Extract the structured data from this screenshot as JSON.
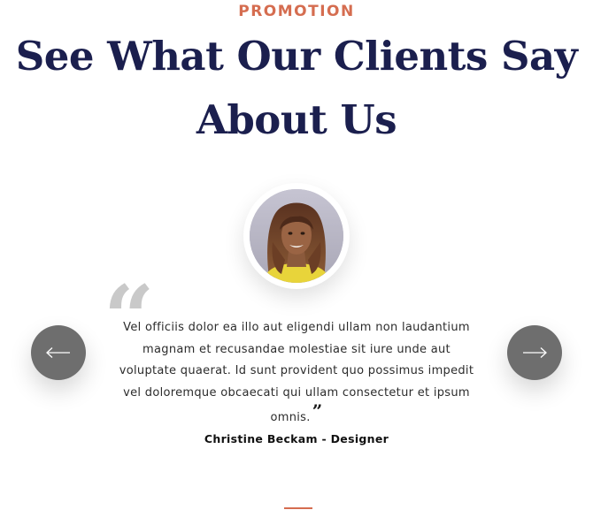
{
  "section": {
    "eyebrow": "PROMOTION",
    "headline": "See What Our Clients Say About Us"
  },
  "testimonial": {
    "quote": "Vel officiis dolor ea illo aut eligendi ullam non laudantium magnam et recusandae molestiae sit iure unde aut voluptate quaerat. Id sunt provident quo possimus impedit vel doloremque obcaecati qui ullam consectetur et ipsum omnis.",
    "author": "Christine Beckam - Designer",
    "open_quote_glyph": "“",
    "close_quote_glyph": "”"
  },
  "navigation": {
    "prev_icon": "arrow-left-icon",
    "next_icon": "arrow-right-icon"
  },
  "colors": {
    "accent": "#d56d50",
    "headline": "#1b1f4e",
    "nav_button": "#6e6e6e",
    "quote_mark": "#c9c9c9"
  }
}
